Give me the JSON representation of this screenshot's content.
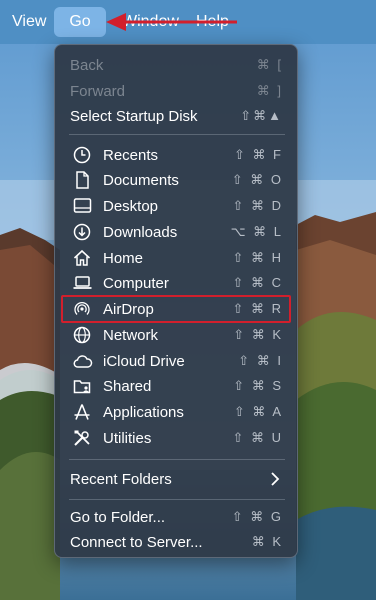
{
  "menubar": {
    "items": [
      "View",
      "Go",
      "Window",
      "Help"
    ],
    "active": "Go"
  },
  "menu": {
    "nav": [
      {
        "label": "Back",
        "shortcut": "⌘ [",
        "enabled": false
      },
      {
        "label": "Forward",
        "shortcut": "⌘ ]",
        "enabled": false
      },
      {
        "label": "Select Startup Disk",
        "shortcut": "⇧⌘▲",
        "enabled": true
      }
    ],
    "places": [
      {
        "label": "Recents",
        "shortcut": "⇧ ⌘ F",
        "icon": "clock-icon"
      },
      {
        "label": "Documents",
        "shortcut": "⇧ ⌘ O",
        "icon": "document-icon"
      },
      {
        "label": "Desktop",
        "shortcut": "⇧ ⌘ D",
        "icon": "desktop-icon"
      },
      {
        "label": "Downloads",
        "shortcut": "⌥ ⌘ L",
        "icon": "download-icon"
      },
      {
        "label": "Home",
        "shortcut": "⇧ ⌘ H",
        "icon": "home-icon"
      },
      {
        "label": "Computer",
        "shortcut": "⇧ ⌘ C",
        "icon": "laptop-icon"
      },
      {
        "label": "AirDrop",
        "shortcut": "⇧ ⌘ R",
        "icon": "airdrop-icon"
      },
      {
        "label": "Network",
        "shortcut": "⇧ ⌘ K",
        "icon": "globe-icon"
      },
      {
        "label": "iCloud Drive",
        "shortcut": "⇧ ⌘ I",
        "icon": "cloud-icon"
      },
      {
        "label": "Shared",
        "shortcut": "⇧ ⌘ S",
        "icon": "shared-folder-icon"
      },
      {
        "label": "Applications",
        "shortcut": "⇧ ⌘ A",
        "icon": "applications-icon"
      },
      {
        "label": "Utilities",
        "shortcut": "⇧ ⌘ U",
        "icon": "utilities-icon"
      }
    ],
    "recent_folders": {
      "label": "Recent Folders"
    },
    "folder": [
      {
        "label": "Go to Folder...",
        "shortcut": "⇧ ⌘ G"
      },
      {
        "label": "Connect to Server...",
        "shortcut": "⌘ K"
      }
    ]
  },
  "colors": {
    "menubar": "#4f8fc4",
    "active_menu": "#7db4e6",
    "highlight_box": "#d21f2c",
    "arrow": "#d21f2c"
  }
}
